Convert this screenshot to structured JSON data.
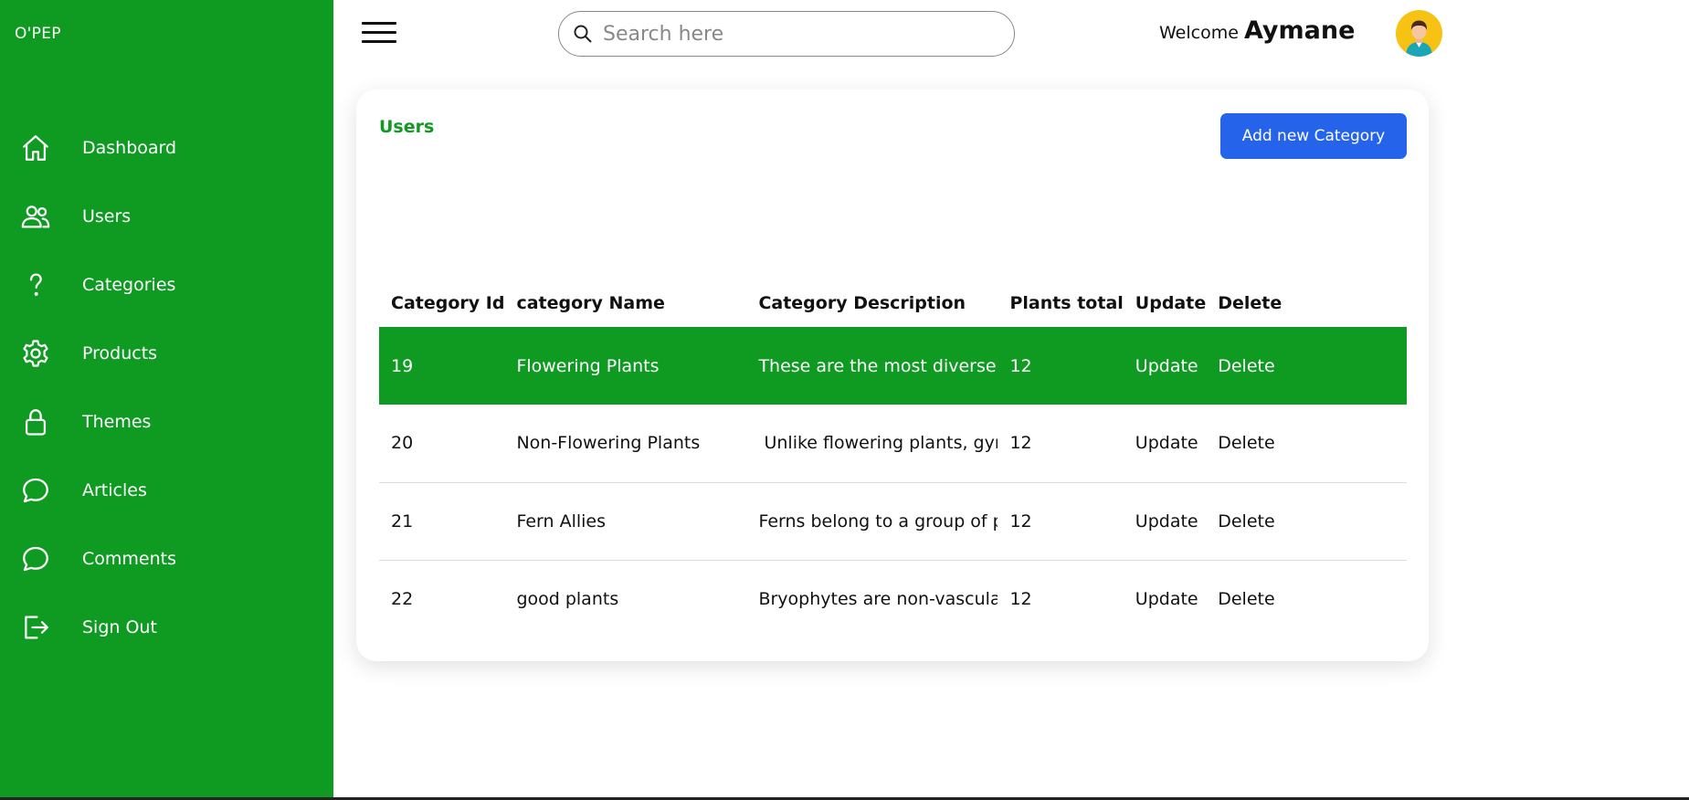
{
  "sidebar": {
    "brand": "O'PEP",
    "items": [
      {
        "label": "Dashboard",
        "icon": "home-icon"
      },
      {
        "label": "Users",
        "icon": "users-icon"
      },
      {
        "label": "Categories",
        "icon": "question-icon"
      },
      {
        "label": "Products",
        "icon": "gear-icon"
      },
      {
        "label": "Themes",
        "icon": "lock-icon"
      },
      {
        "label": "Articles",
        "icon": "chat-icon"
      },
      {
        "label": "Comments",
        "icon": "chat-icon"
      },
      {
        "label": "Sign Out",
        "icon": "sign-out-icon"
      }
    ]
  },
  "header": {
    "search_placeholder": "Search here",
    "welcome_text": "Welcome",
    "user_name": "Aymane"
  },
  "main": {
    "title": "Users",
    "add_button": "Add new Category",
    "columns": [
      "Category Id",
      "category Name",
      "Category Description",
      "Plants total",
      "Update",
      "Delete"
    ],
    "rows": [
      {
        "id": "19",
        "name": "Flowering Plants",
        "description": "These are the most diverse g",
        "total": "12",
        "update": "Update",
        "delete": "Delete"
      },
      {
        "id": "20",
        "name": "Non-Flowering Plants",
        "description": " Unlike flowering plants, gym",
        "total": "12",
        "update": "Update",
        "delete": "Delete"
      },
      {
        "id": "21",
        "name": "Fern Allies",
        "description": "Ferns belong to a group of p",
        "total": "12",
        "update": "Update",
        "delete": "Delete"
      },
      {
        "id": "22",
        "name": "good plants",
        "description": "Bryophytes are non-vascular",
        "total": "12",
        "update": "Update",
        "delete": "Delete"
      }
    ]
  },
  "colors": {
    "sidebar_green": "#0f9a22",
    "button_blue": "#2563eb",
    "avatar_yellow": "#f6c213"
  }
}
